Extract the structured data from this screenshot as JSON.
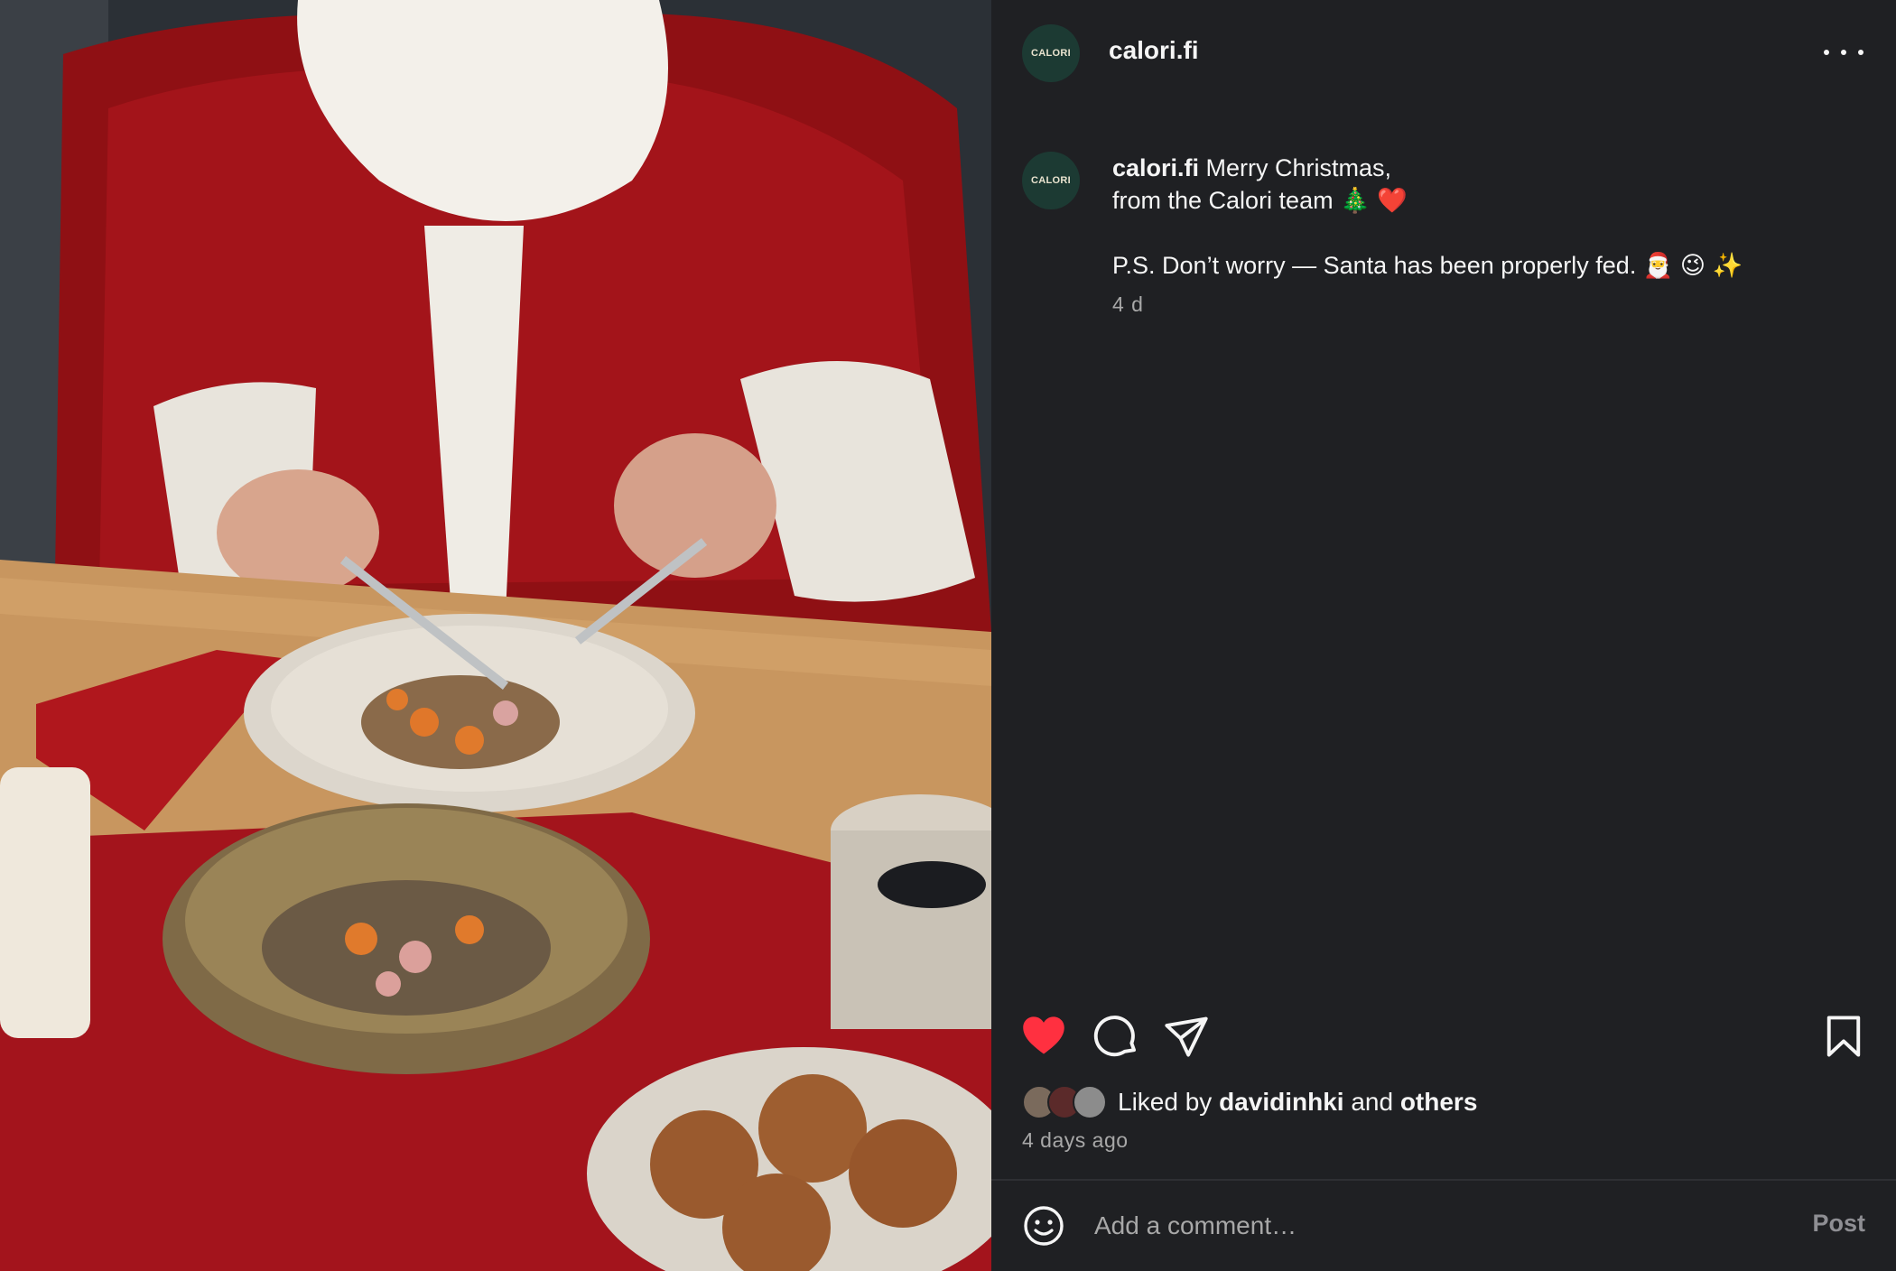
{
  "post": {
    "username": "calori.fi",
    "avatar_text": "CALORI",
    "more_icon": "more-horizontal-icon",
    "photo_description_icon": "post-photo"
  },
  "caption": {
    "username": "calori.fi",
    "line1": "Merry Christmas,",
    "line2": "from the Calori team 🎄 ❤️",
    "ps": "P.S. Don’t worry — Santa has been properly fed. 🎅 😉 ✨",
    "age": "4 d"
  },
  "actions": {
    "like_icon": "heart-filled-icon",
    "comment_icon": "comment-icon",
    "share_icon": "send-icon",
    "save_icon": "bookmark-icon",
    "liked": true
  },
  "likes": {
    "prefix": "Liked by",
    "user": "davidinhki",
    "connector": "and",
    "others": "others"
  },
  "time_ago": "4 days ago",
  "comment": {
    "placeholder": "Add a comment…",
    "post_label": "Post",
    "emoji_icon": "smiley-icon"
  },
  "colors": {
    "panel_bg": "#1f2023",
    "text": "#f5f5f5",
    "muted": "#a8a8a8",
    "like_red": "#ff3040",
    "avatar_bg": "#1c3a33"
  }
}
